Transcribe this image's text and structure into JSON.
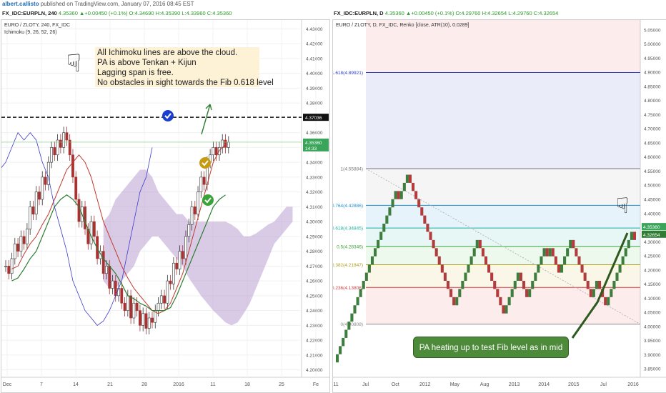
{
  "topbar": {
    "author": "albert.callisto",
    "published": "published on TradingView.com, January 07, 2016 08:45 EST"
  },
  "left_header": {
    "symbol": "FX_IDC:EURPLN, 240",
    "change": "4.35360 ▲+0.00450 (+0.1%)",
    "ohlc": "O:4.34690 H:4.35390 L:4.33960 C:4.35360"
  },
  "right_header": {
    "symbol": "FX_IDC:EURPLN, D",
    "change": "4.35360 ▲+0.00450 (+0.1%)",
    "ohlc": "O:4.29760 H:4.32654 L:4.29760 C:4.32654"
  },
  "left_chart": {
    "series_title": "EURO / ZLOTY, 240, FX_IDC",
    "indicator": "Ichimoku (9, 26, 52, 26)",
    "note_lines": [
      "All Ichimoku lines are above the cloud.",
      "PA is above Tenkan + Kijun",
      "Lagging span is free.",
      "No obstacles in sight towards the Fib 0.618 level"
    ],
    "dashed_level_label": "4.37036",
    "price_label": "4.35360",
    "time_label": "14:33"
  },
  "right_chart": {
    "series_title": "EURO / ZLOTY, D, FX_IDC, Renko [close, ATR(10), 0.0289]",
    "callout": "PA heating up to test Fib level as in mid Dec.",
    "price_label": "4.35360",
    "price_label_2": "4.32654",
    "fib_labels": [
      "1.618(4.89921)",
      "1(4.55884)",
      "0.764(4.42886)",
      "0.618(4.34845)",
      "0.5(4.28346)",
      "0.382(4.21847)",
      "0.236(4.13806)",
      "0(4.00808)"
    ]
  },
  "chart_data": [
    {
      "type": "candlestick",
      "title": "EURO / ZLOTY, 240, FX_IDC",
      "indicator": "Ichimoku (9, 26, 52, 26)",
      "x_tick_labels": [
        "Dec",
        "7",
        "14",
        "21",
        "28",
        "2016",
        "11",
        "18",
        "25",
        "Fe"
      ],
      "y_tick_labels": [
        "4.43000",
        "4.42000",
        "4.41000",
        "4.40000",
        "4.39000",
        "4.38000",
        "4.36000",
        "4.35000",
        "4.34000",
        "4.33000",
        "4.32000",
        "4.31000",
        "4.30000",
        "4.29000",
        "4.28000",
        "4.27000",
        "4.26000",
        "4.25000",
        "4.24000",
        "4.23000",
        "4.22000",
        "4.21000",
        "4.20000"
      ],
      "ylim": [
        4.195,
        4.435
      ],
      "horizontal_level": 4.37036,
      "close_x": [
        0,
        0.5,
        1,
        1.5,
        2,
        2.5,
        3,
        3.5,
        4,
        4.5,
        5,
        5.5,
        6,
        6.5,
        7,
        7.5,
        8,
        8.5,
        9,
        9.5,
        10,
        10.5,
        11,
        11.5,
        12,
        12.5,
        13,
        13.5,
        14,
        14.5,
        15,
        15.5,
        16,
        16.5,
        17,
        17.5,
        18,
        18.5,
        19,
        19.5,
        20,
        20.5,
        21,
        21.5,
        22,
        22.5,
        23,
        23.5,
        24,
        24.5,
        25,
        25.5,
        26,
        26.5,
        27,
        27.5,
        28,
        28.5,
        29,
        29.5,
        30,
        30.5,
        31,
        31.5,
        32,
        32.5,
        33,
        33.5,
        34,
        34.5,
        35,
        35.5,
        36,
        36.5
      ],
      "close": [
        4.27,
        4.265,
        4.275,
        4.285,
        4.28,
        4.29,
        4.285,
        4.295,
        4.31,
        4.305,
        4.32,
        4.315,
        4.33,
        4.325,
        4.34,
        4.35,
        4.345,
        4.355,
        4.35,
        4.36,
        4.355,
        4.345,
        4.33,
        4.315,
        4.3,
        4.31,
        4.295,
        4.285,
        4.3,
        4.29,
        4.275,
        4.28,
        4.265,
        4.27,
        4.255,
        4.26,
        4.25,
        4.255,
        4.245,
        4.24,
        4.25,
        4.235,
        4.245,
        4.24,
        4.23,
        4.238,
        4.228,
        4.235,
        4.232,
        4.24,
        4.245,
        4.25,
        4.245,
        4.26,
        4.258,
        4.272,
        4.268,
        4.28,
        4.275,
        4.29,
        4.298,
        4.31,
        4.305,
        4.32,
        4.33,
        4.325,
        4.34,
        4.345,
        4.35,
        4.345,
        4.35,
        4.355,
        4.35,
        4.3536
      ],
      "tenkan": [
        4.268,
        4.27,
        4.278,
        4.285,
        4.29,
        4.298,
        4.305,
        4.315,
        4.325,
        4.335,
        4.34,
        4.345,
        4.34,
        4.33,
        4.315,
        4.3,
        4.29,
        4.28,
        4.27,
        4.262,
        4.255,
        4.25,
        4.245,
        4.24,
        4.238,
        4.24,
        4.245,
        4.255,
        4.265,
        4.28,
        4.295,
        4.31,
        4.325,
        4.34,
        4.348,
        4.352
      ],
      "kijun": [
        4.26,
        4.262,
        4.268,
        4.275,
        4.28,
        4.29,
        4.3,
        4.31,
        4.315,
        4.318,
        4.315,
        4.31,
        4.3,
        4.29,
        4.282,
        4.275,
        4.27,
        4.265,
        4.258,
        4.25,
        4.248,
        4.245,
        4.243,
        4.24,
        4.24,
        4.24,
        4.242,
        4.25,
        4.26,
        4.27,
        4.28,
        4.29,
        4.3,
        4.31,
        4.315,
        4.318
      ],
      "chikou": [
        4.255,
        4.27,
        4.285,
        4.3,
        4.32,
        4.335,
        4.34,
        4.35,
        4.36,
        4.355,
        4.36,
        4.355,
        4.34,
        4.33,
        4.31,
        4.295,
        4.28,
        4.26,
        4.25,
        4.24,
        4.235,
        4.23,
        4.233,
        4.24,
        4.25,
        4.26,
        4.28,
        4.3,
        4.32,
        4.33,
        4.35
      ],
      "cloud_upper": [
        4.3,
        4.305,
        4.315,
        4.32,
        4.325,
        4.33,
        4.335,
        4.335,
        4.33,
        4.32,
        4.315,
        4.31,
        4.305,
        4.305,
        4.3,
        4.3,
        4.3,
        4.3,
        4.3,
        4.3,
        4.3,
        4.298,
        4.295,
        4.29,
        4.29,
        4.292,
        4.295,
        4.298,
        4.3,
        4.305,
        4.31,
        4.31
      ],
      "cloud_lower": [
        4.26,
        4.255,
        4.255,
        4.26,
        4.265,
        4.27,
        4.28,
        4.285,
        4.29,
        4.29,
        4.285,
        4.28,
        4.275,
        4.27,
        4.262,
        4.256,
        4.25,
        4.245,
        4.24,
        4.236,
        4.232,
        4.23,
        4.232,
        4.238,
        4.245,
        4.255,
        4.265,
        4.275,
        4.285,
        4.29,
        4.295,
        4.3
      ]
    },
    {
      "type": "renko",
      "title": "EURO / ZLOTY, D, FX_IDC, Renko [close, ATR(10), 0.0289]",
      "x_tick_labels": [
        "11",
        "Jul",
        "Oct",
        "2012",
        "May",
        "Aug",
        "2013",
        "2014",
        "2015",
        "Jul",
        "2016"
      ],
      "y_tick_labels": [
        "5.05000",
        "5.00000",
        "4.95000",
        "4.90000",
        "4.85000",
        "4.80000",
        "4.75000",
        "4.70000",
        "4.65000",
        "4.60000",
        "4.55000",
        "4.50000",
        "4.45000",
        "4.40000",
        "4.35000",
        "4.30000",
        "4.25000",
        "4.20000",
        "4.15000",
        "4.10000",
        "4.05000",
        "4.00000",
        "3.95000",
        "3.90000",
        "3.85000"
      ],
      "ylim": [
        3.82,
        5.08
      ],
      "fib_levels": [
        {
          "ratio": "1.618",
          "value": 4.89921,
          "color": "#2a3cc8"
        },
        {
          "ratio": "1",
          "value": 4.55884,
          "color": "#777777"
        },
        {
          "ratio": "0.764",
          "value": 4.42886,
          "color": "#1e8fd0"
        },
        {
          "ratio": "0.618",
          "value": 4.34845,
          "color": "#1ab0a0"
        },
        {
          "ratio": "0.5",
          "value": 4.28346,
          "color": "#3aa03a"
        },
        {
          "ratio": "0.382",
          "value": 4.21847,
          "color": "#b0a020"
        },
        {
          "ratio": "0.236",
          "value": 4.13806,
          "color": "#d04040"
        },
        {
          "ratio": "0",
          "value": 4.00808,
          "color": "#888888"
        }
      ],
      "brick_path": [
        3.88,
        3.94,
        4.02,
        4.1,
        4.2,
        4.3,
        4.38,
        4.44,
        4.4,
        4.47,
        4.5,
        4.45,
        4.5,
        4.56,
        4.5,
        4.42,
        4.35,
        4.3,
        4.22,
        4.15,
        4.1,
        4.05,
        4.12,
        4.2,
        4.28,
        4.32,
        4.28,
        4.2,
        4.12,
        4.06,
        4.03,
        4.1,
        4.06,
        4.1,
        4.06,
        4.12,
        4.18,
        4.2,
        4.14,
        4.1,
        4.2,
        4.26,
        4.3,
        4.24,
        4.3,
        4.24,
        4.18,
        4.22,
        4.28,
        4.32,
        4.28,
        4.2,
        4.14,
        4.1,
        4.18,
        4.12,
        4.05,
        4.08,
        4.15,
        4.2,
        4.26,
        4.3,
        4.35,
        4.28,
        4.33
      ]
    }
  ]
}
